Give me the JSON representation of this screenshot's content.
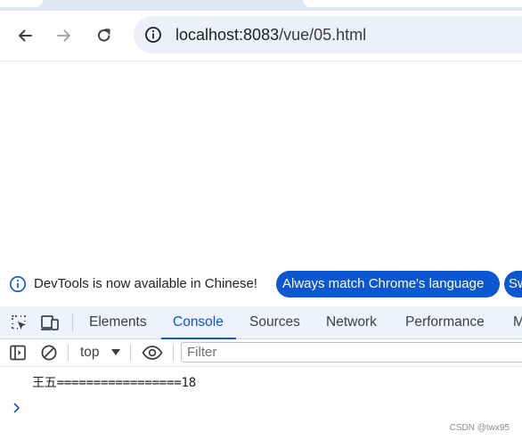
{
  "browser": {
    "url_host": "localhost:8083",
    "url_path": "/vue/05.html"
  },
  "icons": {
    "back": "arrow-left-icon",
    "forward": "arrow-right-icon",
    "reload": "reload-icon",
    "site_info": "info-icon",
    "inspect": "inspect-element-icon",
    "device": "device-toolbar-icon",
    "sidebar": "console-sidebar-icon",
    "clear": "clear-console-icon",
    "eye": "eye-icon",
    "dropdown": "caret-down-icon",
    "prompt": "chevron-right-icon"
  },
  "devtools": {
    "infobar": {
      "message": "DevTools is now available in Chinese!",
      "match_button": "Always match Chrome's language",
      "switch_button": "Sw"
    },
    "tabs": [
      {
        "label": "Elements"
      },
      {
        "label": "Console"
      },
      {
        "label": "Sources"
      },
      {
        "label": "Network"
      },
      {
        "label": "Performance"
      },
      {
        "label": "M"
      }
    ],
    "active_tab": "Console",
    "console": {
      "context": "top",
      "filter_placeholder": "Filter",
      "log_lines": [
        "王五=================18"
      ]
    }
  },
  "watermark": "CSDN @twx95",
  "colors": {
    "accent": "#0b57d0",
    "tabbar_bg": "#eef2fa",
    "omnibox_bg": "#edf0f8",
    "chrome_bg": "#dfe5f3"
  }
}
